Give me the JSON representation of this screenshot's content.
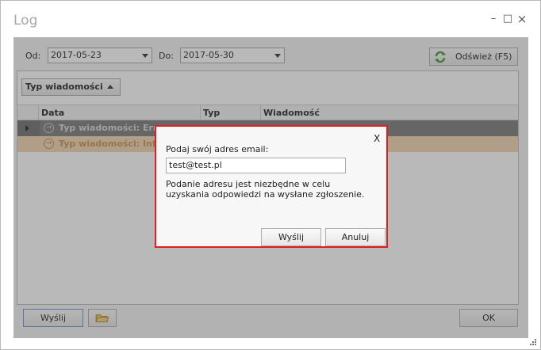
{
  "window": {
    "title": "Log",
    "controls": {
      "minimize": "–",
      "maximize": "□",
      "close": "×"
    }
  },
  "filters": {
    "from_label": "Od:",
    "from_value": "2017-05-23",
    "to_label": "Do:",
    "to_value": "2017-05-30",
    "refresh_label": "Odśwież (F5)",
    "refresh_icon": "refresh-arrows-icon"
  },
  "grid": {
    "group_by_label": "Typ wiadomości",
    "columns": [
      "Data",
      "Typ",
      "Wiadomość"
    ],
    "rows": [
      {
        "label": "Typ wiadomości: Error",
        "visible_text": "Typ wiadomości: Erro",
        "state": "selected"
      },
      {
        "label": "Typ wiadomości: Info",
        "visible_text": "Typ wiadomości: Info",
        "state": "highlight"
      }
    ]
  },
  "footer": {
    "send_label": "Wyślij",
    "folder_icon": "folder-open-icon",
    "ok_label": "OK"
  },
  "dialog": {
    "close_label": "X",
    "prompt": "Podaj swój adres email:",
    "email_value": "test@test.pl",
    "note": "Podanie adresu jest niezbędne w celu uzyskania odpowiedzi na wysłane zgłoszenie.",
    "send_label": "Wyślij",
    "cancel_label": "Anuluj",
    "border_color": "#e01f1f"
  }
}
